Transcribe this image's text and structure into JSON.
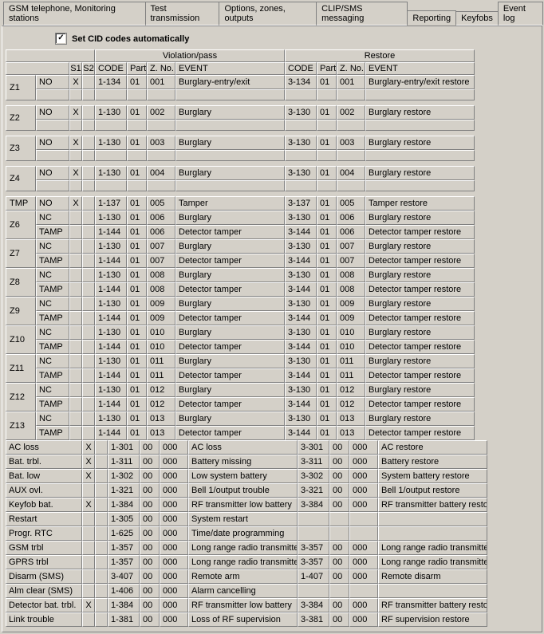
{
  "tabs": [
    "GSM telephone, Monitoring stations",
    "Test transmission",
    "Options, zones, outputs",
    "CLIP/SMS messaging",
    "Reporting",
    "Keyfobs",
    "Event log"
  ],
  "active_tab": 4,
  "checkbox_label": "Set CID codes automatically",
  "headers": {
    "group_v": "Violation/pass",
    "group_r": "Restore",
    "s1": "S1",
    "s2": "S2",
    "code": "CODE",
    "part": "Part.",
    "zno": "Z. No.",
    "event": "EVENT"
  },
  "zone_pairs": [
    {
      "label": "Z1",
      "a": {
        "sig": "NO",
        "s1": true,
        "vc": "1-134",
        "vp": "01",
        "vz": "001",
        "ve": "Burglary-entry/exit",
        "rc": "3-134",
        "rp": "01",
        "rz": "001",
        "re": "Burglary-entry/exit restore"
      },
      "b": {
        "sig": "",
        "s1": false
      }
    },
    {
      "label": "Z2",
      "a": {
        "sig": "NO",
        "s1": true,
        "vc": "1-130",
        "vp": "01",
        "vz": "002",
        "ve": "Burglary",
        "rc": "3-130",
        "rp": "01",
        "rz": "002",
        "re": "Burglary restore"
      },
      "b": {
        "sig": "",
        "s1": false
      }
    },
    {
      "label": "Z3",
      "a": {
        "sig": "NO",
        "s1": true,
        "vc": "1-130",
        "vp": "01",
        "vz": "003",
        "ve": "Burglary",
        "rc": "3-130",
        "rp": "01",
        "rz": "003",
        "re": "Burglary restore"
      },
      "b": {
        "sig": "",
        "s1": false
      }
    },
    {
      "label": "Z4",
      "a": {
        "sig": "NO",
        "s1": true,
        "vc": "1-130",
        "vp": "01",
        "vz": "004",
        "ve": "Burglary",
        "rc": "3-130",
        "rp": "01",
        "rz": "004",
        "re": "Burglary restore"
      },
      "b": {
        "sig": "",
        "s1": false
      }
    }
  ],
  "tmp": {
    "label": "TMP",
    "sig": "NO",
    "s1": true,
    "vc": "1-137",
    "vp": "01",
    "vz": "005",
    "ve": "Tamper",
    "rc": "3-137",
    "rp": "01",
    "rz": "005",
    "re": "Tamper restore"
  },
  "zone_dbl": [
    {
      "label": "Z6",
      "a": {
        "sig": "NC",
        "vc": "1-130",
        "vp": "01",
        "vz": "006",
        "ve": "Burglary",
        "rc": "3-130",
        "rp": "01",
        "rz": "006",
        "re": "Burglary restore"
      },
      "b": {
        "sig": "TAMP",
        "vc": "1-144",
        "vp": "01",
        "vz": "006",
        "ve": "Detector tamper",
        "rc": "3-144",
        "rp": "01",
        "rz": "006",
        "re": "Detector tamper restore"
      }
    },
    {
      "label": "Z7",
      "a": {
        "sig": "NC",
        "vc": "1-130",
        "vp": "01",
        "vz": "007",
        "ve": "Burglary",
        "rc": "3-130",
        "rp": "01",
        "rz": "007",
        "re": "Burglary restore"
      },
      "b": {
        "sig": "TAMP",
        "vc": "1-144",
        "vp": "01",
        "vz": "007",
        "ve": "Detector tamper",
        "rc": "3-144",
        "rp": "01",
        "rz": "007",
        "re": "Detector tamper restore"
      }
    },
    {
      "label": "Z8",
      "a": {
        "sig": "NC",
        "vc": "1-130",
        "vp": "01",
        "vz": "008",
        "ve": "Burglary",
        "rc": "3-130",
        "rp": "01",
        "rz": "008",
        "re": "Burglary restore"
      },
      "b": {
        "sig": "TAMP",
        "vc": "1-144",
        "vp": "01",
        "vz": "008",
        "ve": "Detector tamper",
        "rc": "3-144",
        "rp": "01",
        "rz": "008",
        "re": "Detector tamper restore"
      }
    },
    {
      "label": "Z9",
      "a": {
        "sig": "NC",
        "vc": "1-130",
        "vp": "01",
        "vz": "009",
        "ve": "Burglary",
        "rc": "3-130",
        "rp": "01",
        "rz": "009",
        "re": "Burglary restore"
      },
      "b": {
        "sig": "TAMP",
        "vc": "1-144",
        "vp": "01",
        "vz": "009",
        "ve": "Detector tamper",
        "rc": "3-144",
        "rp": "01",
        "rz": "009",
        "re": "Detector tamper restore"
      }
    },
    {
      "label": "Z10",
      "a": {
        "sig": "NC",
        "vc": "1-130",
        "vp": "01",
        "vz": "010",
        "ve": "Burglary",
        "rc": "3-130",
        "rp": "01",
        "rz": "010",
        "re": "Burglary restore"
      },
      "b": {
        "sig": "TAMP",
        "vc": "1-144",
        "vp": "01",
        "vz": "010",
        "ve": "Detector tamper",
        "rc": "3-144",
        "rp": "01",
        "rz": "010",
        "re": "Detector tamper restore"
      }
    },
    {
      "label": "Z11",
      "a": {
        "sig": "NC",
        "vc": "1-130",
        "vp": "01",
        "vz": "011",
        "ve": "Burglary",
        "rc": "3-130",
        "rp": "01",
        "rz": "011",
        "re": "Burglary restore"
      },
      "b": {
        "sig": "TAMP",
        "vc": "1-144",
        "vp": "01",
        "vz": "011",
        "ve": "Detector tamper",
        "rc": "3-144",
        "rp": "01",
        "rz": "011",
        "re": "Detector tamper restore"
      }
    },
    {
      "label": "Z12",
      "a": {
        "sig": "NC",
        "vc": "1-130",
        "vp": "01",
        "vz": "012",
        "ve": "Burglary",
        "rc": "3-130",
        "rp": "01",
        "rz": "012",
        "re": "Burglary restore"
      },
      "b": {
        "sig": "TAMP",
        "vc": "1-144",
        "vp": "01",
        "vz": "012",
        "ve": "Detector tamper",
        "rc": "3-144",
        "rp": "01",
        "rz": "012",
        "re": "Detector tamper restore"
      }
    },
    {
      "label": "Z13",
      "a": {
        "sig": "NC",
        "vc": "1-130",
        "vp": "01",
        "vz": "013",
        "ve": "Burglary",
        "rc": "3-130",
        "rp": "01",
        "rz": "013",
        "re": "Burglary restore"
      },
      "b": {
        "sig": "TAMP",
        "vc": "1-144",
        "vp": "01",
        "vz": "013",
        "ve": "Detector tamper",
        "rc": "3-144",
        "rp": "01",
        "rz": "013",
        "re": "Detector tamper restore"
      }
    }
  ],
  "misc": [
    {
      "label": "AC loss",
      "s1": true,
      "vc": "1-301",
      "vp": "00",
      "vz": "000",
      "ve": "AC loss",
      "rc": "3-301",
      "rp": "00",
      "rz": "000",
      "re": "AC restore"
    },
    {
      "label": "Bat. trbl.",
      "s1": true,
      "vc": "1-311",
      "vp": "00",
      "vz": "000",
      "ve": "Battery missing",
      "rc": "3-311",
      "rp": "00",
      "rz": "000",
      "re": "Battery restore"
    },
    {
      "label": "Bat. low",
      "s1": true,
      "vc": "1-302",
      "vp": "00",
      "vz": "000",
      "ve": "Low system battery",
      "rc": "3-302",
      "rp": "00",
      "rz": "000",
      "re": "System battery restore"
    },
    {
      "label": "AUX ovl.",
      "s1": false,
      "vc": "1-321",
      "vp": "00",
      "vz": "000",
      "ve": "Bell 1/output trouble",
      "rc": "3-321",
      "rp": "00",
      "rz": "000",
      "re": "Bell 1/output restore"
    },
    {
      "label": "Keyfob bat.",
      "s1": true,
      "vc": "1-384",
      "vp": "00",
      "vz": "000",
      "ve": "RF transmitter low battery",
      "rc": "3-384",
      "rp": "00",
      "rz": "000",
      "re": "RF transmitter battery restore"
    },
    {
      "label": "Restart",
      "s1": false,
      "vc": "1-305",
      "vp": "00",
      "vz": "000",
      "ve": "System restart",
      "rc": "",
      "rp": "",
      "rz": "",
      "re": ""
    },
    {
      "label": "Progr. RTC",
      "s1": false,
      "vc": "1-625",
      "vp": "00",
      "vz": "000",
      "ve": "Time/date programming",
      "rc": "",
      "rp": "",
      "rz": "",
      "re": ""
    },
    {
      "label": "GSM trbl",
      "s1": false,
      "vc": "1-357",
      "vp": "00",
      "vz": "000",
      "ve": "Long range radio transmitter VSWR",
      "rc": "3-357",
      "rp": "00",
      "rz": "000",
      "re": "Long range radio transmitter VSWR"
    },
    {
      "label": "GPRS trbl",
      "s1": false,
      "vc": "1-357",
      "vp": "00",
      "vz": "000",
      "ve": "Long range radio transmitter VSWR",
      "rc": "3-357",
      "rp": "00",
      "rz": "000",
      "re": "Long range radio transmitter VSWR"
    },
    {
      "label": "Disarm (SMS)",
      "s1": false,
      "vc": "3-407",
      "vp": "00",
      "vz": "000",
      "ve": "Remote arm",
      "rc": "1-407",
      "rp": "00",
      "rz": "000",
      "re": "Remote disarm"
    },
    {
      "label": "Alm clear (SMS)",
      "s1": false,
      "vc": "1-406",
      "vp": "00",
      "vz": "000",
      "ve": "Alarm cancelling",
      "rc": "",
      "rp": "",
      "rz": "",
      "re": ""
    },
    {
      "label": "Detector bat. trbl.",
      "s1": true,
      "vc": "1-384",
      "vp": "00",
      "vz": "000",
      "ve": "RF transmitter low battery",
      "rc": "3-384",
      "rp": "00",
      "rz": "000",
      "re": "RF transmitter battery restore"
    },
    {
      "label": "Link trouble",
      "s1": false,
      "vc": "1-381",
      "vp": "00",
      "vz": "000",
      "ve": "Loss of RF supervision",
      "rc": "3-381",
      "rp": "00",
      "rz": "000",
      "re": "RF supervision restore"
    }
  ]
}
